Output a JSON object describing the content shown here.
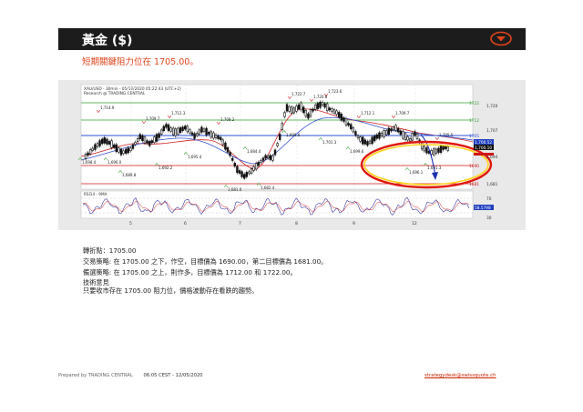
{
  "header": {
    "title": "黃金 ($)",
    "menu_icon": "chevron-down-circle-icon",
    "accent": "#e0431a"
  },
  "headline": "短期關鍵阻力位在 1705.00。",
  "chart": {
    "title_line1": "XAU/USD - 30min - 05/12/2020 05:22:43 (UTC+2)",
    "title_line2": "Research @ TRADING CENTRAL",
    "price_ticks": [
      "1,720",
      "1,707",
      "1,694",
      "1,681"
    ],
    "level_labels": [
      {
        "text": "1722",
        "color": "#2ea02e"
      },
      {
        "text": "1712",
        "color": "#2ea02e"
      },
      {
        "text": "1705",
        "color": "#2a4fd8"
      },
      {
        "text": "1690",
        "color": "#d01515"
      },
      {
        "text": "1681",
        "color": "#d01515"
      }
    ],
    "current_price_1": "1,700.52",
    "current_price_2": "1,700.10",
    "peak_labels": [
      "1,714.9",
      "1,709.7",
      "1,712.3",
      "1,708.2",
      "1,722.7",
      "1,720.8",
      "1,723.6",
      "1,712.1",
      "1,709.7",
      "1,705.5"
    ],
    "trough_labels": [
      "1,698.4",
      "1,696.0",
      "1,692.2",
      "1,695.4",
      "1,689.8",
      "1,684.4",
      "1,681.0",
      "1,682.4",
      "1,699.6",
      "1,701.3",
      "1,699.6",
      "1,696.1",
      "1,691.3"
    ],
    "rsi_label": "RSI14 - 9MA",
    "rsi_ticks": [
      "70",
      "30"
    ],
    "rsi_value": "58.5798",
    "date_ticks": [
      "5",
      "6",
      "7",
      "8",
      "9",
      "12"
    ]
  },
  "notes": {
    "pivot": "轉折點：1705.00",
    "strategy": "交易策略: 在 1705.00 之下，作空，目標價為  1690.00，第二目標價為  1681.00。",
    "alternative": "備選策略: 在 1705.00 之上，則作多，目標價為  1712.00 和 1722.00。",
    "technical_title": "技術意見",
    "technical_body": "只要收市存在 1705.00 阻力位，價格波動存在看跌的趨勢。"
  },
  "footer": {
    "prepared": "Prepared by TRADING CENTRAL",
    "time": "06:05 CEST - 12/05/2020",
    "email": "strategydesk@swissquote.ch"
  }
}
